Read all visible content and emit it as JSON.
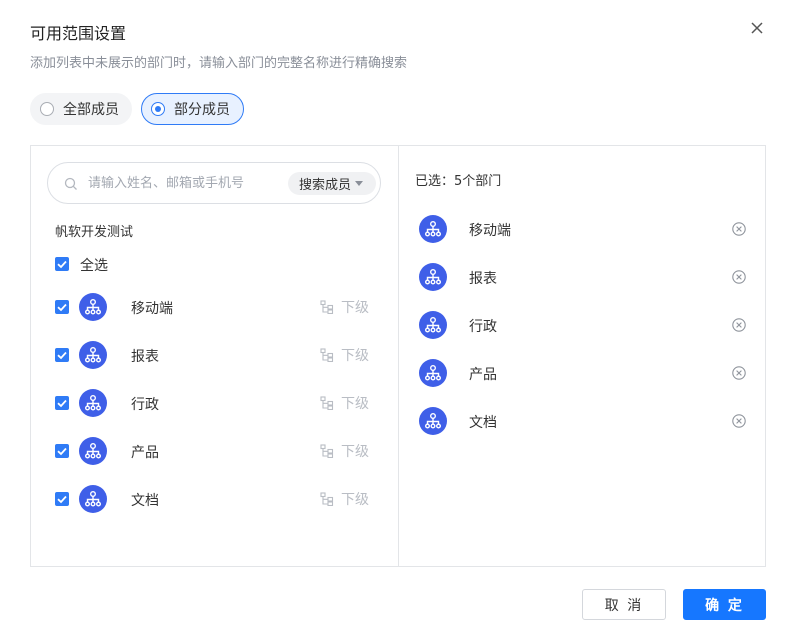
{
  "dialog": {
    "title": "可用范围设置",
    "subtitle": "添加列表中未展示的部门时，请输入部门的完整名称进行精确搜索"
  },
  "scope": {
    "options": [
      {
        "label": "全部成员",
        "selected": false
      },
      {
        "label": "部分成员",
        "selected": true
      }
    ]
  },
  "search": {
    "placeholder": "请输入姓名、邮箱或手机号",
    "select_value": "搜索成员"
  },
  "tree": {
    "org_name": "帆软开发测试",
    "select_all_label": "全选",
    "select_all_checked": true,
    "sub_level_label": "下级",
    "departments": [
      {
        "label": "移动端",
        "checked": true
      },
      {
        "label": "报表",
        "checked": true
      },
      {
        "label": "行政",
        "checked": true
      },
      {
        "label": "产品",
        "checked": true
      },
      {
        "label": "文档",
        "checked": true
      }
    ]
  },
  "selected": {
    "summary": "已选：5个部门",
    "items": [
      "移动端",
      "报表",
      "行政",
      "产品",
      "文档"
    ]
  },
  "footer": {
    "cancel_label": "取 消",
    "confirm_label": "确 定"
  },
  "colors": {
    "accent": "#2f7bf6",
    "confirm_button": "#1677ff",
    "avatar": "#3f5fe8"
  },
  "icons": {
    "close": "close-icon",
    "search": "search-icon",
    "dropdown": "chevron-down-icon",
    "department": "org-tree-icon",
    "sub_level": "hierarchy-icon",
    "remove": "remove-circle-icon",
    "check": "checkmark-icon"
  }
}
